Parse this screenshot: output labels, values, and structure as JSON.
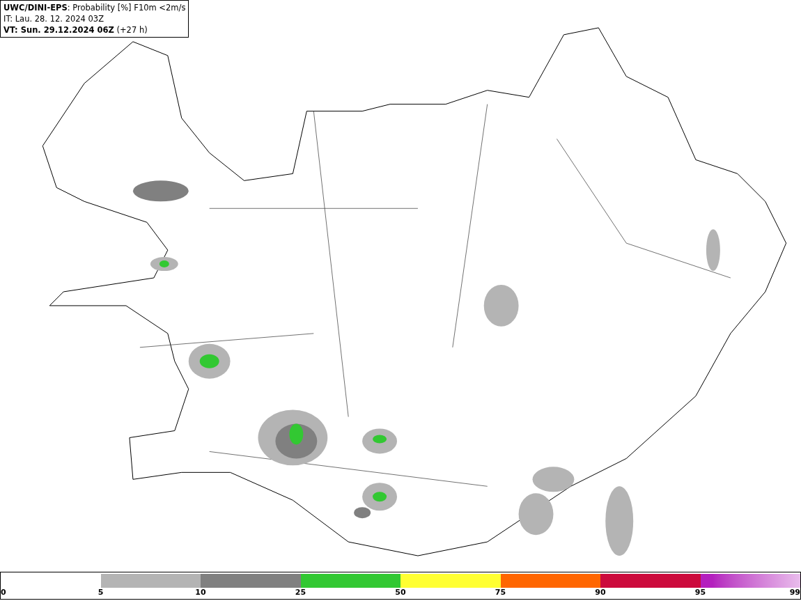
{
  "header": {
    "title": "**UWC/DINI-EPS**: Probability [%] F10m <2m/s",
    "issue_time": "IT: Lau. 28. 12. 2024 03Z",
    "valid_time": "**VT: Sun. 29.12.2024 06Z** (+27 h)"
  },
  "legend": {
    "segments": [
      {
        "color": "#b4b4b4"
      },
      {
        "color": "#808080"
      },
      {
        "color": "#32c832"
      },
      {
        "color": "#ffff32"
      },
      {
        "color": "#ff6600"
      },
      {
        "color": "#cc0a3c"
      },
      {
        "color": "#b41fbe",
        "kind": "gradient"
      }
    ],
    "labels": [
      "0",
      "5",
      "10",
      "25",
      "50",
      "75",
      "90",
      "95",
      "99"
    ]
  }
}
